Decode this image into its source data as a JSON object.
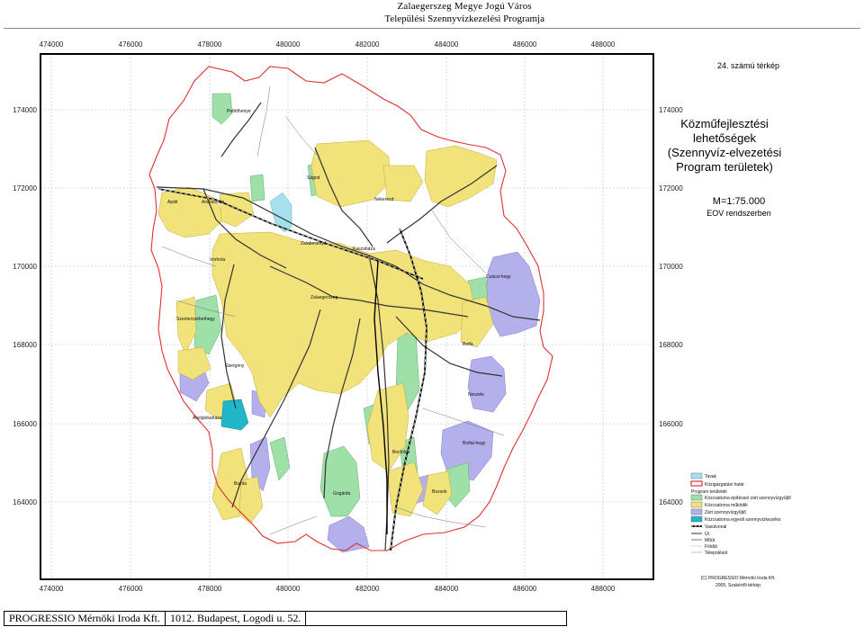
{
  "header": {
    "line1": "Zalaegerszeg Megye Jogú Város",
    "line2": "Települési Szennyvízkezelési Programja"
  },
  "map": {
    "map_number": "24. számú térkép",
    "title_lines": [
      "Közműfejlesztési",
      "lehetőségek",
      "(Szennyvíz-elvezetési",
      "Program területek)"
    ],
    "scale": "M=1:75.000",
    "projection": "EOV rendszerben",
    "x_coords": [
      "474000",
      "476000",
      "478000",
      "480000",
      "482000",
      "484000",
      "486000",
      "488000"
    ],
    "y_coords": [
      "174000",
      "172000",
      "170000",
      "168000",
      "166000",
      "164000"
    ],
    "place_names": [
      "Pethőhenye",
      "Apáti",
      "Andráshida",
      "Ságod",
      "Nekeresd",
      "Zalabesenyő",
      "Csácsi-hegy",
      "Vorhota",
      "Zalaegerszeg",
      "Szenterzsébethegy",
      "Botfa",
      "Bazita",
      "Bozsok",
      "Botfai-hegy",
      "Kaszaháza",
      "Neszele",
      "Ebergény",
      "Alsójánkaháza",
      "Gógánfa",
      "Bocfölde"
    ],
    "legend": [
      {
        "label": "Tavak",
        "color": "#a6e0ec"
      },
      {
        "label": "Közigazgatási határ",
        "color": "#e03030"
      },
      {
        "label": "Program területek",
        "color": ""
      },
      {
        "label": "Közcsatorna építéssel zárt szennyvízgyűjtő",
        "color": "#9ee0a8"
      },
      {
        "label": "Közcsatorna működik",
        "color": "#f2e27a"
      },
      {
        "label": "Zárt szennyvízgyűjtő",
        "color": "#b4b0ec"
      },
      {
        "label": "Közcsatorna egyedi szennyvízkezelés",
        "color": "#20b8c8"
      },
      {
        "label": "Vasútvonal",
        "color": "#000000"
      },
      {
        "label": "Út",
        "color": "#555555"
      },
      {
        "label": "Műút",
        "color": "#555555"
      },
      {
        "label": "Földút",
        "color": "#999999"
      },
      {
        "label": "Településút",
        "color": "#999999"
      }
    ],
    "credit_lines": [
      "(C) PROGRESSIO Mérnöki Iroda Kft.",
      "2005. Szakértői térkép"
    ]
  },
  "footer": {
    "company": "PROGRESSIO Mérnöki Iroda Kft.",
    "address": "1012. Budapest, Logodi u. 52."
  }
}
